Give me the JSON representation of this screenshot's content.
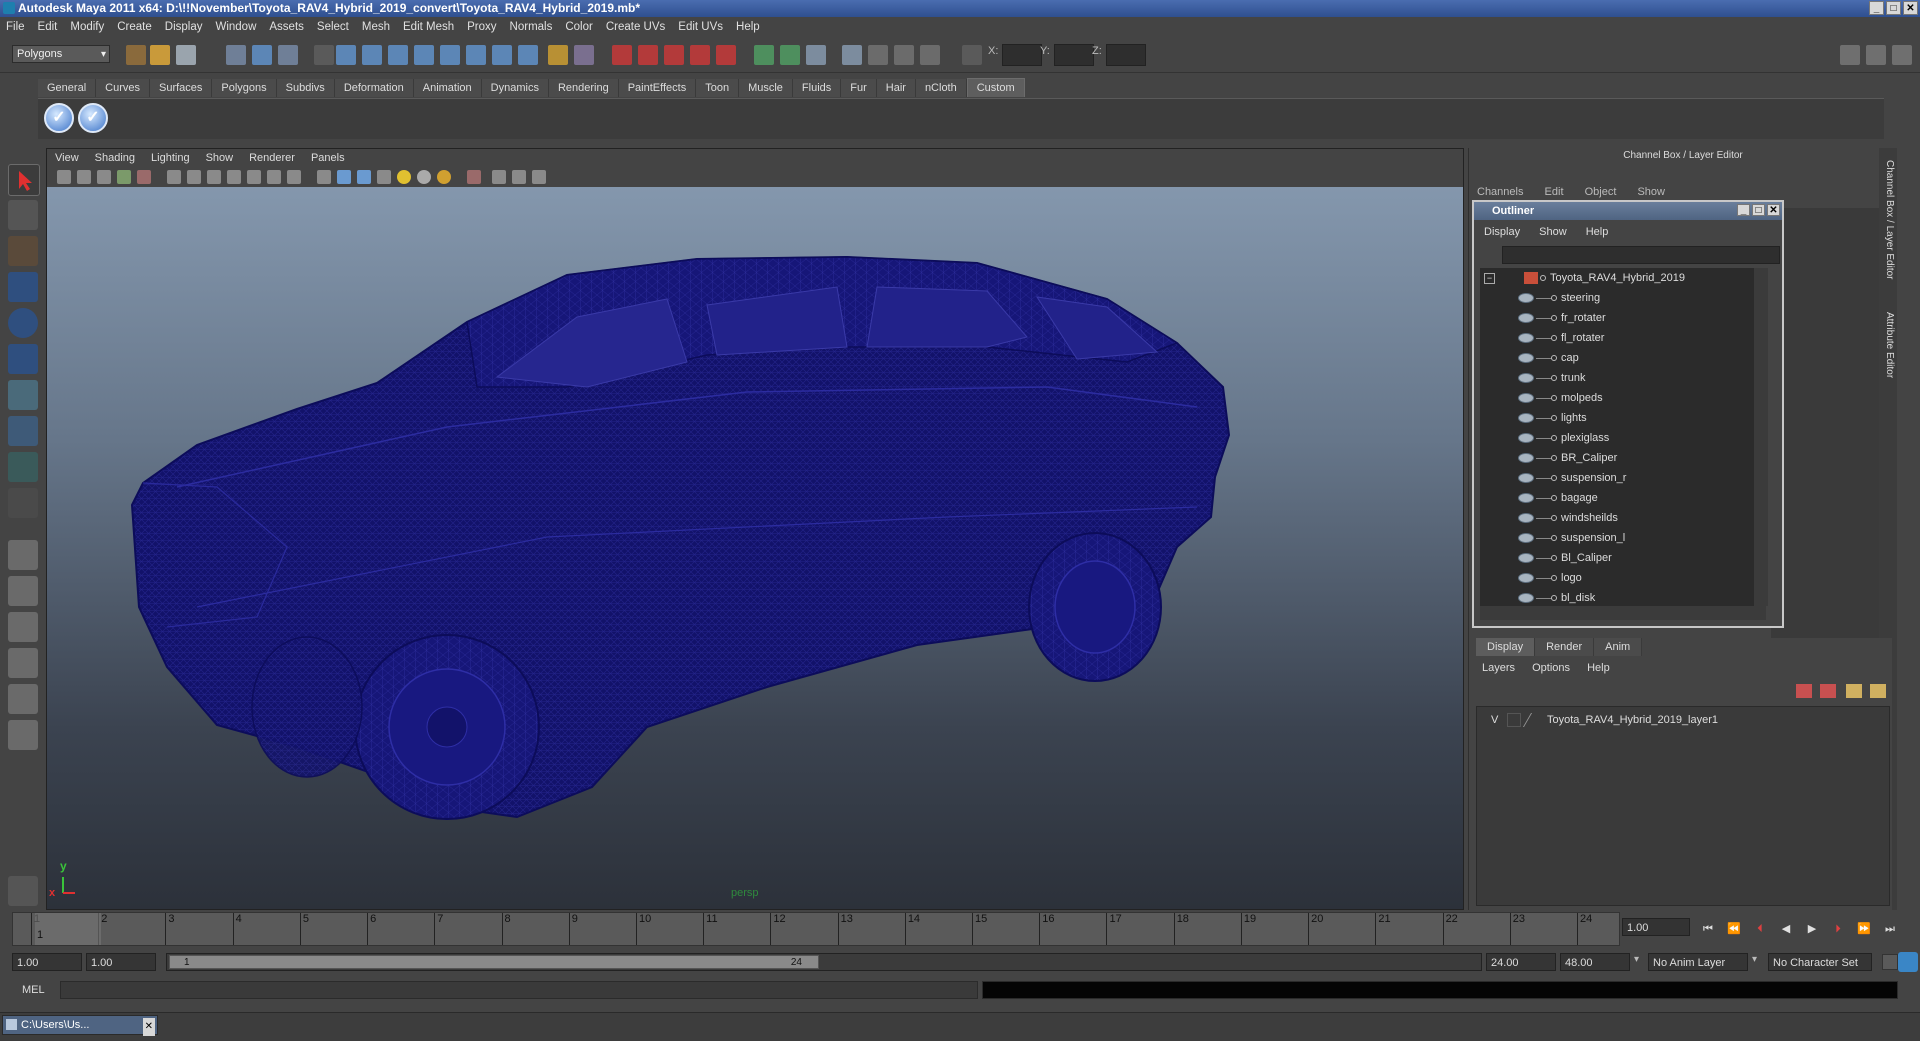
{
  "window": {
    "title": "Autodesk Maya 2011 x64: D:\\!!November\\Toyota_RAV4_Hybrid_2019_convert\\Toyota_RAV4_Hybrid_2019.mb*"
  },
  "menu": [
    "File",
    "Edit",
    "Modify",
    "Create",
    "Display",
    "Window",
    "Assets",
    "Select",
    "Mesh",
    "Edit Mesh",
    "Proxy",
    "Normals",
    "Color",
    "Create UVs",
    "Edit UVs",
    "Help"
  ],
  "status": {
    "mode": "Polygons",
    "x_label": "X:",
    "y_label": "Y:",
    "z_label": "Z:"
  },
  "shelf": {
    "tabs": [
      "General",
      "Curves",
      "Surfaces",
      "Polygons",
      "Subdivs",
      "Deformation",
      "Animation",
      "Dynamics",
      "Rendering",
      "PaintEffects",
      "Toon",
      "Muscle",
      "Fluids",
      "Fur",
      "Hair",
      "nCloth",
      "Custom"
    ],
    "active_tab": "Custom"
  },
  "viewport": {
    "menu": [
      "View",
      "Shading",
      "Lighting",
      "Show",
      "Renderer",
      "Panels"
    ],
    "camera_label": "persp",
    "axis_y": "y",
    "axis_x": "x",
    "wireframe_color": "#11116e"
  },
  "channel_box": {
    "title": "Channel Box / Layer Editor",
    "menu": [
      "Channels",
      "Edit",
      "Object",
      "Show"
    ],
    "side_tabs": [
      "Channel Box / Layer Editor",
      "Attribute Editor"
    ]
  },
  "outliner": {
    "title": "Outliner",
    "menu": [
      "Display",
      "Show",
      "Help"
    ],
    "root": "Toyota_RAV4_Hybrid_2019",
    "items": [
      "steering",
      "fr_rotater",
      "fl_rotater",
      "cap",
      "trunk",
      "molpeds",
      "lights",
      "plexiglass",
      "BR_Caliper",
      "suspension_r",
      "bagage",
      "windsheilds",
      "suspension_l",
      "Bl_Caliper",
      "logo",
      "bl_disk"
    ]
  },
  "layer_editor": {
    "tabs": [
      "Display",
      "Render",
      "Anim"
    ],
    "active_tab": "Display",
    "menu": [
      "Layers",
      "Options",
      "Help"
    ],
    "layer_visible": "V",
    "layer_name": "Toyota_RAV4_Hybrid_2019_layer1"
  },
  "timeline": {
    "ticks": [
      "1",
      "2",
      "3",
      "4",
      "5",
      "6",
      "7",
      "8",
      "9",
      "10",
      "11",
      "12",
      "13",
      "14",
      "15",
      "16",
      "17",
      "18",
      "19",
      "20",
      "21",
      "22",
      "23",
      "24"
    ],
    "current_frame_marker": "1",
    "current_frame": "1.00"
  },
  "range": {
    "start_time": "1.00",
    "playback_start": "1.00",
    "thumb_start": "1",
    "thumb_end": "24",
    "playback_end": "24.00",
    "end_time": "48.00",
    "anim_layer": "No Anim Layer",
    "character_set": "No Character Set"
  },
  "command_line": {
    "label": "MEL"
  },
  "taskbar": {
    "item": "C:\\Users\\Us..."
  }
}
